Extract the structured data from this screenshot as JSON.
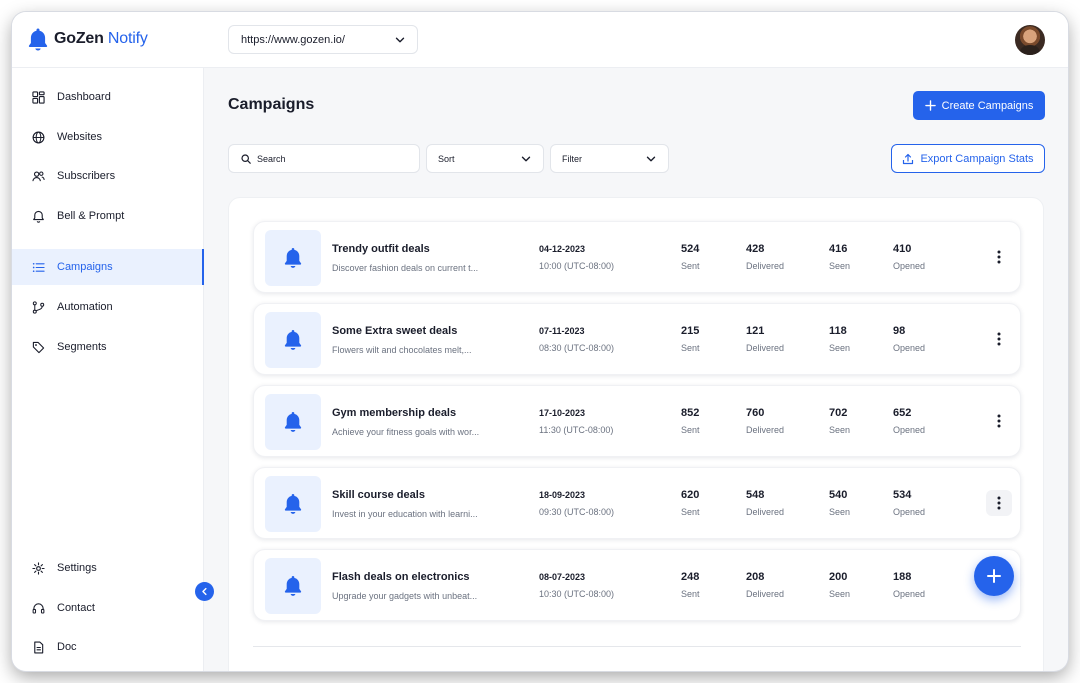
{
  "app": {
    "brand_main": "GoZen",
    "brand_accent": "Notify"
  },
  "header": {
    "website_url": "https://www.gozen.io/"
  },
  "sidebar": {
    "items": [
      {
        "label": "Dashboard",
        "icon": "dashboard-icon"
      },
      {
        "label": "Websites",
        "icon": "globe-icon"
      },
      {
        "label": "Subscribers",
        "icon": "users-icon"
      },
      {
        "label": "Bell & Prompt",
        "icon": "bell-icon"
      },
      {
        "label": "Campaigns",
        "icon": "list-icon",
        "active": true
      },
      {
        "label": "Automation",
        "icon": "branch-icon"
      },
      {
        "label": "Segments",
        "icon": "tag-icon"
      }
    ],
    "bottom_items": [
      {
        "label": "Settings",
        "icon": "gear-icon"
      },
      {
        "label": "Contact",
        "icon": "headset-icon"
      },
      {
        "label": "Doc",
        "icon": "document-icon"
      }
    ]
  },
  "main": {
    "title": "Campaigns",
    "create_label": "Create Campaigns",
    "search_placeholder": "Search",
    "sort_label": "Sort",
    "filter_label": "Filter",
    "export_label": "Export Campaign Stats",
    "stat_labels": {
      "sent": "Sent",
      "delivered": "Delivered",
      "seen": "Seen",
      "opened": "Opened"
    },
    "campaigns": [
      {
        "name": "Trendy outfit deals",
        "description": "Discover fashion deals on current t...",
        "date": "04-12-2023",
        "time": "10:00 (UTC-08:00)",
        "sent": "524",
        "delivered": "428",
        "seen": "416",
        "opened": "410"
      },
      {
        "name": "Some Extra sweet deals",
        "description": "Flowers wilt and chocolates melt,...",
        "date": "07-11-2023",
        "time": "08:30 (UTC-08:00)",
        "sent": "215",
        "delivered": "121",
        "seen": "118",
        "opened": "98"
      },
      {
        "name": "Gym membership deals",
        "description": "Achieve your fitness goals with wor...",
        "date": "17-10-2023",
        "time": "11:30 (UTC-08:00)",
        "sent": "852",
        "delivered": "760",
        "seen": "702",
        "opened": "652"
      },
      {
        "name": "Skill course deals",
        "description": "Invest in your education with learni...",
        "date": "18-09-2023",
        "time": "09:30 (UTC-08:00)",
        "sent": "620",
        "delivered": "548",
        "seen": "540",
        "opened": "534"
      },
      {
        "name": "Flash deals on electronics",
        "description": "Upgrade your gadgets with unbeat...",
        "date": "08-07-2023",
        "time": "10:30 (UTC-08:00)",
        "sent": "248",
        "delivered": "208",
        "seen": "200",
        "opened": "188"
      }
    ]
  },
  "colors": {
    "accent": "#2563eb",
    "accent_light": "#eaf1fe",
    "text": "#1a1d2b",
    "muted": "#6b7280"
  }
}
